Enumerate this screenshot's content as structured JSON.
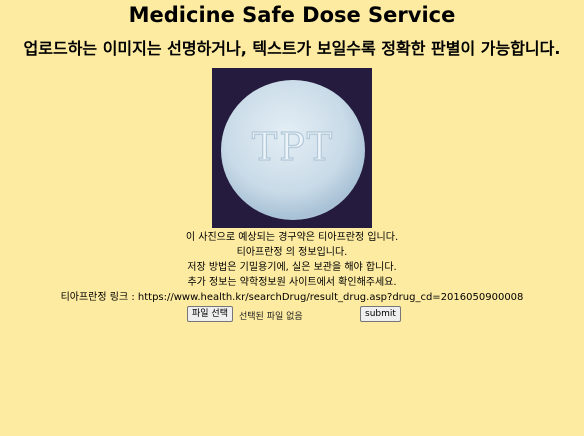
{
  "header": {
    "title": "Medicine Safe Dose Service",
    "subtitle": "업로드하는 이미지는 선명하거나, 텍스트가 보일수록 정확한 판별이 가능합니다."
  },
  "image": {
    "imprint": "TPT",
    "background_color": "#241b3e",
    "pill_color": "#d6e4ee"
  },
  "result": {
    "prediction": "이 사진으로 예상되는 경구약은 티아프란정 입니다.",
    "info_title": "티아프란정 의 정보입니다.",
    "storage": "저장 방법은 기밀용기에, 실은 보관을 해야 합니다.",
    "more_info": "추가 정보는 약학정보원 사이트에서 확인해주세요.",
    "link": "티아프란정 링크 : https://www.health.kr/searchDrug/result_drug.asp?drug_cd=2016050900008"
  },
  "form": {
    "file_button": "파일 선택",
    "file_status": "선택된 파일 없음",
    "submit_label": "submit"
  }
}
